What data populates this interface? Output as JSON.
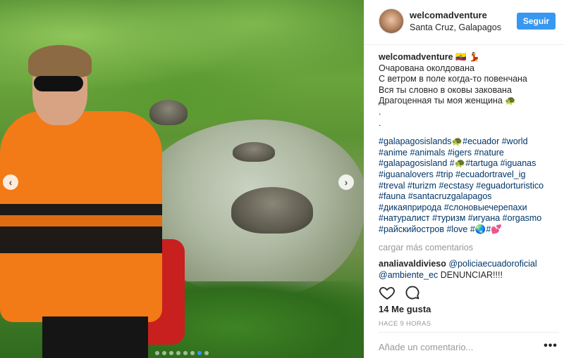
{
  "post": {
    "username": "welcomadventure",
    "location": "Santa Cruz, Galapagos",
    "follow_label": "Seguir",
    "caption_user": "welcomadventure",
    "caption_suffix": " 🇪🇨 💃",
    "caption_lines": [
      "Очарована околдована",
      "С ветром в поле когда-то повенчана",
      "Вся ты словно в оковы закована",
      "Драгоценная ты моя женщина 🐢",
      ".",
      "."
    ],
    "hashtag_lines": [
      "#galapagosislands🐢#ecuador #world",
      "#anime #animals #igers #nature",
      "#galapagosisland #🐢#tartuga #iguanas",
      "#iguanalovers #trip #ecuadortravel_ig",
      "#treval #turizm #ecstasy #eguadorturistico",
      "#fauna #santacruzgalapagos",
      "#дикаяприрода #слоновыечерепахи",
      "#натуралист #туризм #игуана #orgasmo",
      "#райскийостров #love #🌏#💕"
    ],
    "load_more_label": "cargar más comentarios",
    "comments": [
      {
        "user": "analiavaldivieso",
        "mentions": " @policiaecuadoroficial @ambiente_ec",
        "text": " DENUNCIAR!!!!"
      }
    ],
    "likes_label": "14 Me gusta",
    "time_label": "HACE 9 HORAS",
    "comment_placeholder": "Añade un comentario...",
    "more_options_label": "•••",
    "photo": {
      "carousel_dots": 8,
      "active_dot": 6
    }
  },
  "icons": {
    "like": "heart-icon",
    "comment": "speech-bubble-icon",
    "prev": "chevron-left-icon",
    "next": "chevron-right-icon"
  },
  "colors": {
    "accent": "#3897f0",
    "hashtag": "#003569",
    "muted": "#999999"
  }
}
